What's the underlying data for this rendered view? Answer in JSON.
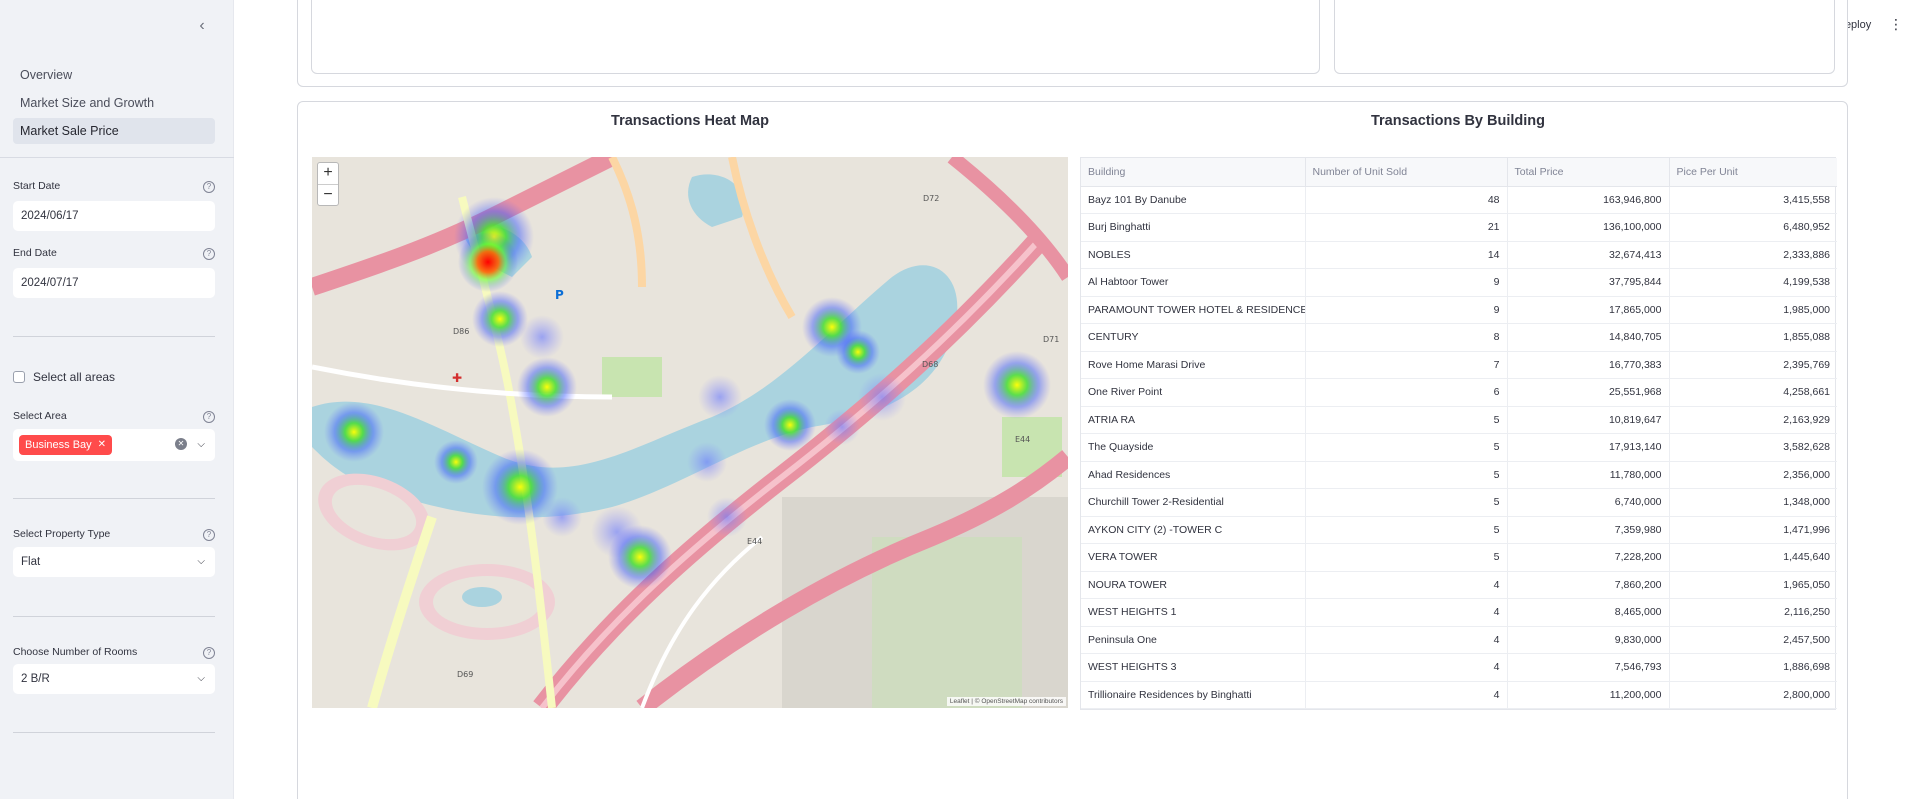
{
  "sidebar": {
    "collapse_icon": "chevron-left-icon",
    "nav": [
      "Overview",
      "Market Size and Growth",
      "Market Sale Price"
    ],
    "start_date": {
      "label": "Start Date",
      "value": "2024/06/17"
    },
    "end_date": {
      "label": "End Date",
      "value": "2024/07/17"
    },
    "select_all_label": "Select all areas",
    "select_area": {
      "label": "Select Area",
      "tag": "Business Bay"
    },
    "property_type": {
      "label": "Select Property Type",
      "value": "Flat"
    },
    "rooms": {
      "label": "Choose Number of Rooms",
      "value": "2 B/R"
    }
  },
  "header": {
    "deploy_label": "Deploy"
  },
  "heatmap": {
    "title": "Transactions Heat Map",
    "zoom_in": "+",
    "zoom_out": "−",
    "attribution": "Leaflet | © OpenStreetMap contributors"
  },
  "table": {
    "title": "Transactions By Building",
    "columns": [
      "Building",
      "Number of Unit Sold",
      "Total Price",
      "Pice Per Unit"
    ],
    "rows": [
      [
        "Bayz 101 By Danube",
        "48",
        "163,946,800",
        "3,415,558"
      ],
      [
        "Burj Binghatti",
        "21",
        "136,100,000",
        "6,480,952"
      ],
      [
        "NOBLES",
        "14",
        "32,674,413",
        "2,333,886"
      ],
      [
        "Al Habtoor Tower",
        "9",
        "37,795,844",
        "4,199,538"
      ],
      [
        "PARAMOUNT TOWER HOTEL & RESIDENCES",
        "9",
        "17,865,000",
        "1,985,000"
      ],
      [
        "CENTURY",
        "8",
        "14,840,705",
        "1,855,088"
      ],
      [
        "Rove Home Marasi Drive",
        "7",
        "16,770,383",
        "2,395,769"
      ],
      [
        "One River Point",
        "6",
        "25,551,968",
        "4,258,661"
      ],
      [
        "ATRIA RA",
        "5",
        "10,819,647",
        "2,163,929"
      ],
      [
        "The Quayside",
        "5",
        "17,913,140",
        "3,582,628"
      ],
      [
        "Ahad Residences",
        "5",
        "11,780,000",
        "2,356,000"
      ],
      [
        "Churchill Tower 2-Residential",
        "5",
        "6,740,000",
        "1,348,000"
      ],
      [
        "AYKON CITY (2) -TOWER C",
        "5",
        "7,359,980",
        "1,471,996"
      ],
      [
        "VERA TOWER",
        "5",
        "7,228,200",
        "1,445,640"
      ],
      [
        "NOURA TOWER",
        "4",
        "7,860,200",
        "1,965,050"
      ],
      [
        "WEST HEIGHTS 1",
        "4",
        "8,465,000",
        "2,116,250"
      ],
      [
        "Peninsula One",
        "4",
        "9,830,000",
        "2,457,500"
      ],
      [
        "WEST HEIGHTS 3",
        "4",
        "7,546,793",
        "1,886,698"
      ],
      [
        "Trillionaire Residences by Binghatti",
        "4",
        "11,200,000",
        "2,800,000"
      ]
    ]
  }
}
